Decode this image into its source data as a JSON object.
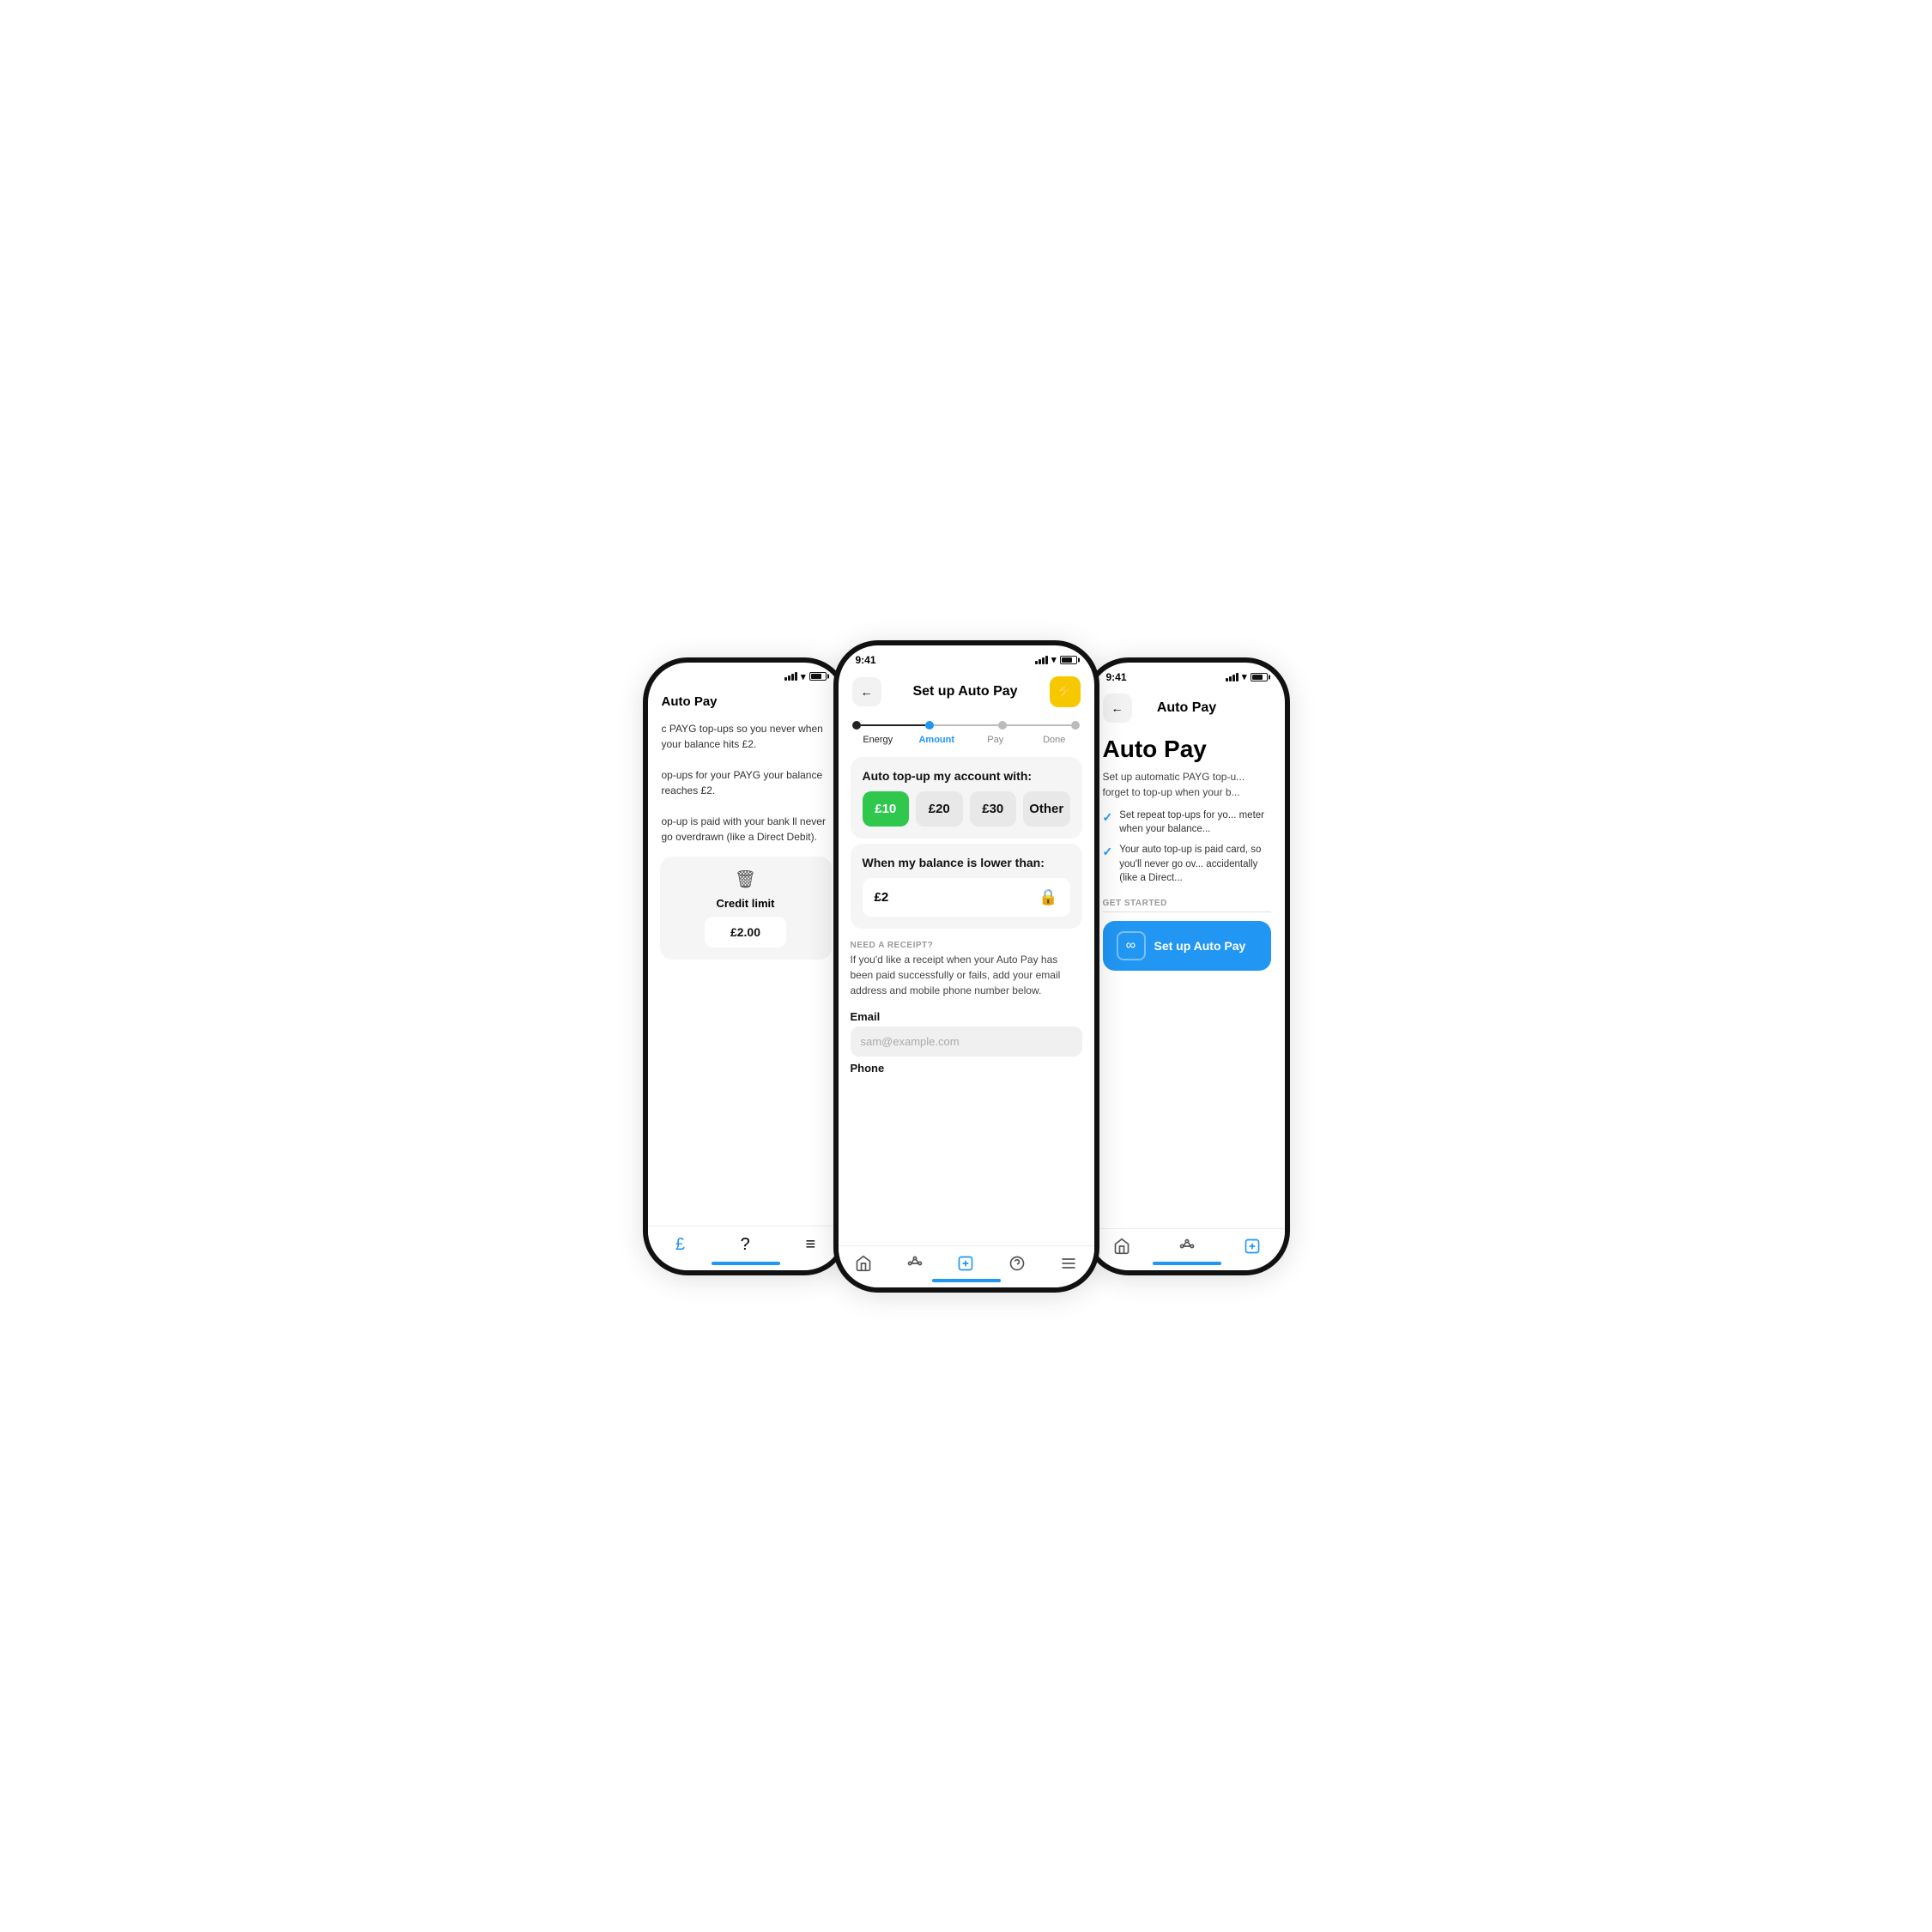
{
  "phones": {
    "left": {
      "title": "Auto Pay",
      "body_text_1": "c PAYG top-ups so you never when your balance hits £2.",
      "body_text_2": "op-ups for your PAYG your balance reaches £2.",
      "body_text_3": "op-up is paid with your bank ll never go overdrawn (like a Direct Debit).",
      "credit_limit_label": "Credit limit",
      "credit_limit_value": "£2.00",
      "nav_items": [
        "£",
        "?",
        "≡"
      ]
    },
    "center": {
      "status_time": "9:41",
      "header_title": "Set up Auto Pay",
      "back_label": "←",
      "steps": [
        {
          "label": "Energy",
          "state": "done"
        },
        {
          "label": "Amount",
          "state": "active"
        },
        {
          "label": "Pay",
          "state": "inactive"
        },
        {
          "label": "Done",
          "state": "inactive"
        }
      ],
      "topup_card": {
        "title": "Auto top-up my account with:",
        "amounts": [
          {
            "label": "£10",
            "selected": true
          },
          {
            "label": "£20",
            "selected": false
          },
          {
            "label": "£30",
            "selected": false
          },
          {
            "label": "Other",
            "selected": false
          }
        ]
      },
      "balance_card": {
        "title": "When my balance is lower than:",
        "value": "£2"
      },
      "receipt_section": {
        "heading": "NEED A RECEIPT?",
        "description": "If you'd like a receipt when your Auto Pay has been paid successfully or fails, add your email address and mobile phone number below.",
        "email_label": "Email",
        "email_placeholder": "sam@example.com",
        "phone_label": "Phone"
      },
      "nav_items": [
        "home",
        "network",
        "account",
        "help",
        "menu"
      ]
    },
    "right": {
      "status_time": "9:41",
      "header_title": "Auto Pay",
      "back_label": "←",
      "main_title": "Auto Pay",
      "description": "Set up automatic PAYG top-u... forget to top-up when your b...",
      "checklist": [
        "Set repeat top-ups for yo... meter when your balance...",
        "Your auto top-up is paid card, so you'll never go ov... accidentally (like a Direct..."
      ],
      "get_started_label": "GET STARTED",
      "setup_btn_label": "Set up Auto Pay",
      "nav_items": [
        "home",
        "network",
        "account"
      ]
    }
  }
}
